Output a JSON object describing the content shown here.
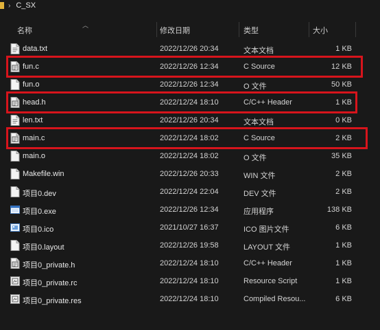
{
  "breadcrumb": {
    "folder": "C_SX"
  },
  "columns": {
    "name": "名称",
    "date": "修改日期",
    "type": "类型",
    "size": "大小"
  },
  "files": [
    {
      "name": "data.txt",
      "date": "2022/12/26 20:34",
      "type": "文本文档",
      "size": "1 KB",
      "icon": "text-file-icon",
      "highlighted": false
    },
    {
      "name": "fun.c",
      "date": "2022/12/26 12:34",
      "type": "C Source",
      "size": "12 KB",
      "icon": "c-source-file-icon",
      "highlighted": true
    },
    {
      "name": "fun.o",
      "date": "2022/12/26 12:34",
      "type": "O 文件",
      "size": "50 KB",
      "icon": "blank-file-icon",
      "highlighted": false
    },
    {
      "name": "head.h",
      "date": "2022/12/24 18:10",
      "type": "C/C++ Header",
      "size": "1 KB",
      "icon": "header-file-icon",
      "highlighted": true
    },
    {
      "name": "len.txt",
      "date": "2022/12/26 20:34",
      "type": "文本文档",
      "size": "0 KB",
      "icon": "text-file-icon",
      "highlighted": false
    },
    {
      "name": "main.c",
      "date": "2022/12/24 18:02",
      "type": "C Source",
      "size": "2 KB",
      "icon": "c-source-file-icon",
      "highlighted": true
    },
    {
      "name": "main.o",
      "date": "2022/12/24 18:02",
      "type": "O 文件",
      "size": "35 KB",
      "icon": "blank-file-icon",
      "highlighted": false
    },
    {
      "name": "Makefile.win",
      "date": "2022/12/26 20:33",
      "type": "WIN 文件",
      "size": "2 KB",
      "icon": "blank-file-icon",
      "highlighted": false
    },
    {
      "name": "项目0.dev",
      "date": "2022/12/24 22:04",
      "type": "DEV 文件",
      "size": "2 KB",
      "icon": "blank-file-icon",
      "highlighted": false
    },
    {
      "name": "项目0.exe",
      "date": "2022/12/26 12:34",
      "type": "应用程序",
      "size": "138 KB",
      "icon": "application-icon",
      "highlighted": false
    },
    {
      "name": "项目0.ico",
      "date": "2021/10/27 16:37",
      "type": "ICO 图片文件",
      "size": "6 KB",
      "icon": "image-file-icon",
      "highlighted": false
    },
    {
      "name": "项目0.layout",
      "date": "2022/12/26 19:58",
      "type": "LAYOUT 文件",
      "size": "1 KB",
      "icon": "blank-file-icon",
      "highlighted": false
    },
    {
      "name": "项目0_private.h",
      "date": "2022/12/24 18:10",
      "type": "C/C++ Header",
      "size": "1 KB",
      "icon": "header-file-icon",
      "highlighted": false
    },
    {
      "name": "项目0_private.rc",
      "date": "2022/12/24 18:10",
      "type": "Resource Script",
      "size": "1 KB",
      "icon": "resource-file-icon",
      "highlighted": false
    },
    {
      "name": "项目0_private.res",
      "date": "2022/12/24 18:10",
      "type": "Compiled Resou...",
      "size": "6 KB",
      "icon": "resource-file-icon",
      "highlighted": false
    }
  ],
  "colors": {
    "highlight": "#d7141c",
    "background": "#191919",
    "folder": "#e2b33b"
  }
}
